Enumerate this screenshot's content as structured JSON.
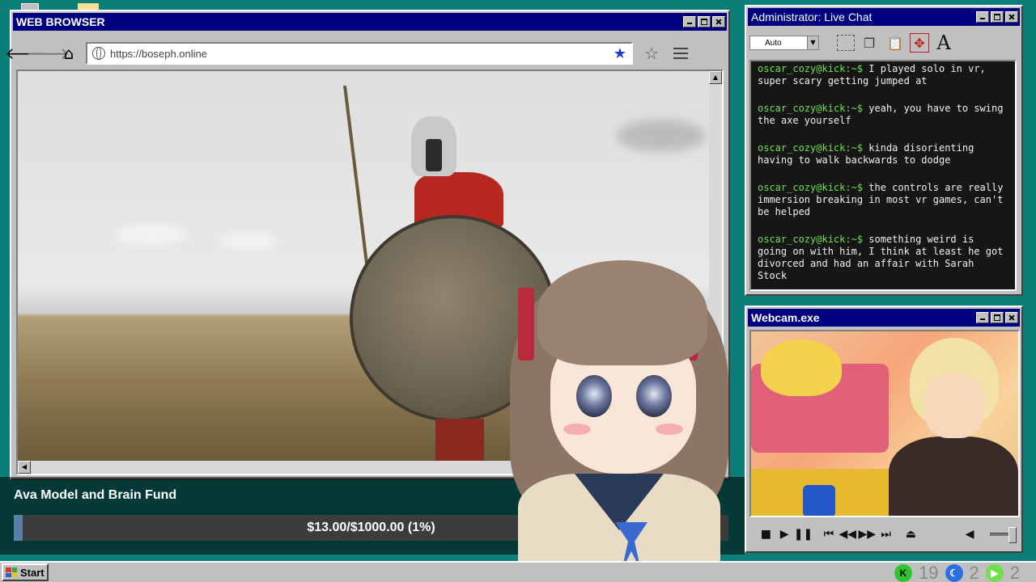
{
  "browser": {
    "title": "WEB BROWSER",
    "url": "https://boseph.online",
    "back_icon": "arrow-left-icon",
    "forward_icon": "arrow-right-icon",
    "home_icon": "home-icon",
    "bookmark_icon": "star-filled-icon",
    "favorite_icon": "star-outline-icon",
    "menu_icon": "hamburger-icon"
  },
  "chat": {
    "title": "Administrator: Live Chat",
    "font_select_value": "Auto",
    "messages": [
      {
        "user": "oscar_cozy@kick:~$",
        "text": "I played solo in vr, super scary getting jumped at"
      },
      {
        "user": "oscar_cozy@kick:~$",
        "text": "yeah, you have to swing the axe yourself"
      },
      {
        "user": "oscar_cozy@kick:~$",
        "text": "kinda disorienting having to walk backwards to dodge"
      },
      {
        "user": "oscar_cozy@kick:~$",
        "text": "the controls are really immersion breaking in most vr games, can't be helped"
      },
      {
        "user": "oscar_cozy@kick:~$",
        "text": "something weird is going on with him, I think at least he got divorced and had an affair with Sarah Stock"
      }
    ]
  },
  "webcam": {
    "title": "Webcam.exe"
  },
  "fund": {
    "title": "Ava Model and Brain Fund",
    "progress_text": "$13.00/$1000.00 (1%)",
    "progress_fraction": 0.013
  },
  "taskbar": {
    "start_label": "Start",
    "kick_count": "19",
    "moon_count": "2",
    "play_count": "2"
  },
  "colors": {
    "desktop": "#0b7f77",
    "titlebar": "#000080",
    "chat_username": "#6fe04a",
    "fund_fill": "#5a7fa6"
  }
}
